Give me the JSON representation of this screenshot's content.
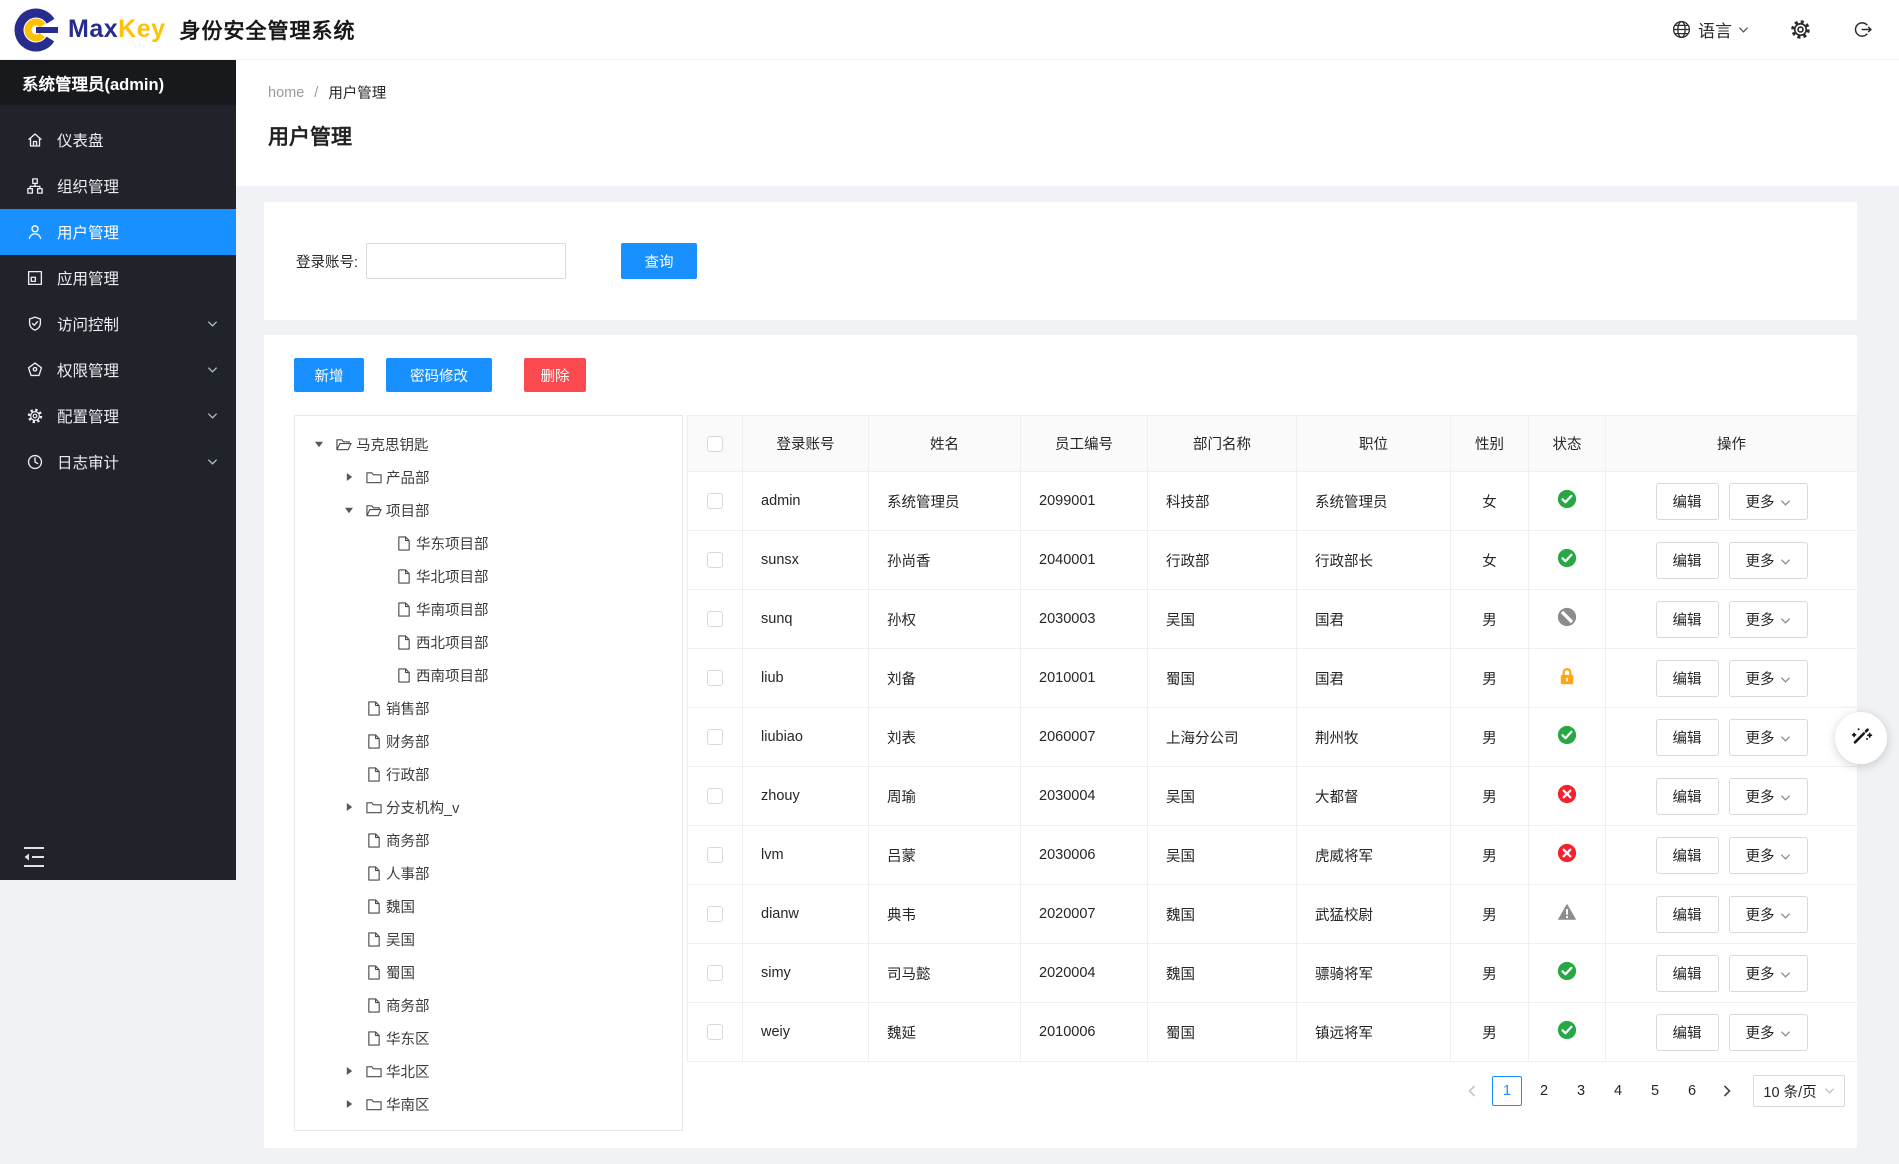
{
  "colors": {
    "primary": "#1890ff",
    "danger": "#fb4b50",
    "page-bg": "#f0f2f5",
    "sidebar-bg": "#20232a",
    "sidebar-active": "#1890ff",
    "brand-navy": "#272c8e",
    "brand-gold": "#fdc106",
    "status-active": "#28a745",
    "status-error": "#f5222d",
    "status-locked": "#ffa514",
    "status-disabled": "#8c8c8c"
  },
  "topbar": {
    "brand_max": "Max",
    "brand_key": "Key",
    "brand_product": "身份安全管理系统",
    "language_label": "语言"
  },
  "sidebar": {
    "user_label": "系统管理员(admin)",
    "items": [
      {
        "id": "dashboard",
        "label": "仪表盘",
        "icon": "home",
        "active": false,
        "expandable": false
      },
      {
        "id": "org",
        "label": "组织管理",
        "icon": "cluster",
        "active": false,
        "expandable": false
      },
      {
        "id": "user",
        "label": "用户管理",
        "icon": "user",
        "active": true,
        "expandable": false
      },
      {
        "id": "app",
        "label": "应用管理",
        "icon": "appstore",
        "active": false,
        "expandable": false
      },
      {
        "id": "access",
        "label": "访问控制",
        "icon": "shield",
        "active": false,
        "expandable": true
      },
      {
        "id": "permission",
        "label": "权限管理",
        "icon": "pentagon",
        "active": false,
        "expandable": true
      },
      {
        "id": "config",
        "label": "配置管理",
        "icon": "gear",
        "active": false,
        "expandable": true
      },
      {
        "id": "audit",
        "label": "日志审计",
        "icon": "clock",
        "active": false,
        "expandable": true
      }
    ]
  },
  "breadcrumb": {
    "home": "home",
    "separator": "/",
    "current": "用户管理"
  },
  "page": {
    "title": "用户管理"
  },
  "search": {
    "label": "登录账号:",
    "value": "",
    "button": "查询"
  },
  "toolbar": {
    "add": "新增",
    "change_password": "密码修改",
    "delete": "删除"
  },
  "tree": {
    "items": [
      {
        "label": "马克思钥匙",
        "level": 0,
        "node": "folder-open",
        "caret": "down"
      },
      {
        "label": "产品部",
        "level": 1,
        "node": "folder",
        "caret": "right"
      },
      {
        "label": "项目部",
        "level": 1,
        "node": "folder-open",
        "caret": "down"
      },
      {
        "label": "华东项目部",
        "level": 2,
        "node": "file",
        "caret": "none"
      },
      {
        "label": "华北项目部",
        "level": 2,
        "node": "file",
        "caret": "none"
      },
      {
        "label": "华南项目部",
        "level": 2,
        "node": "file",
        "caret": "none"
      },
      {
        "label": "西北项目部",
        "level": 2,
        "node": "file",
        "caret": "none"
      },
      {
        "label": "西南项目部",
        "level": 2,
        "node": "file",
        "caret": "none"
      },
      {
        "label": "销售部",
        "level": 1,
        "node": "file",
        "caret": "none"
      },
      {
        "label": "财务部",
        "level": 1,
        "node": "file",
        "caret": "none"
      },
      {
        "label": "行政部",
        "level": 1,
        "node": "file",
        "caret": "none"
      },
      {
        "label": "分支机构_v",
        "level": 1,
        "node": "folder",
        "caret": "right"
      },
      {
        "label": "商务部",
        "level": 1,
        "node": "file",
        "caret": "none"
      },
      {
        "label": "人事部",
        "level": 1,
        "node": "file",
        "caret": "none"
      },
      {
        "label": "魏国",
        "level": 1,
        "node": "file",
        "caret": "none"
      },
      {
        "label": "吴国",
        "level": 1,
        "node": "file",
        "caret": "none"
      },
      {
        "label": "蜀国",
        "level": 1,
        "node": "file",
        "caret": "none"
      },
      {
        "label": "商务部",
        "level": 1,
        "node": "file",
        "caret": "none"
      },
      {
        "label": "华东区",
        "level": 1,
        "node": "file",
        "caret": "none"
      },
      {
        "label": "华北区",
        "level": 1,
        "node": "folder",
        "caret": "right"
      },
      {
        "label": "华南区",
        "level": 1,
        "node": "folder",
        "caret": "right"
      }
    ]
  },
  "table": {
    "columns": [
      "登录账号",
      "姓名",
      "员工编号",
      "部门名称",
      "职位",
      "性别",
      "状态",
      "操作"
    ],
    "actions": {
      "edit": "编辑",
      "more": "更多"
    },
    "rows": [
      {
        "login": "admin",
        "name": "系统管理员",
        "empno": "2099001",
        "dept": "科技部",
        "position": "系统管理员",
        "gender": "女",
        "status": "active"
      },
      {
        "login": "sunsx",
        "name": "孙尚香",
        "empno": "2040001",
        "dept": "行政部",
        "position": "行政部长",
        "gender": "女",
        "status": "active"
      },
      {
        "login": "sunq",
        "name": "孙权",
        "empno": "2030003",
        "dept": "吴国",
        "position": "国君",
        "gender": "男",
        "status": "disabled"
      },
      {
        "login": "liub",
        "name": "刘备",
        "empno": "2010001",
        "dept": "蜀国",
        "position": "国君",
        "gender": "男",
        "status": "locked"
      },
      {
        "login": "liubiao",
        "name": "刘表",
        "empno": "2060007",
        "dept": "上海分公司",
        "position": "荆州牧",
        "gender": "男",
        "status": "active"
      },
      {
        "login": "zhouy",
        "name": "周瑜",
        "empno": "2030004",
        "dept": "吴国",
        "position": "大都督",
        "gender": "男",
        "status": "error"
      },
      {
        "login": "lvm",
        "name": "吕蒙",
        "empno": "2030006",
        "dept": "吴国",
        "position": "虎威将军",
        "gender": "男",
        "status": "error"
      },
      {
        "login": "dianw",
        "name": "典韦",
        "empno": "2020007",
        "dept": "魏国",
        "position": "武猛校尉",
        "gender": "男",
        "status": "warning"
      },
      {
        "login": "simy",
        "name": "司马懿",
        "empno": "2020004",
        "dept": "魏国",
        "position": "骠骑将军",
        "gender": "男",
        "status": "active"
      },
      {
        "login": "weiy",
        "name": "魏延",
        "empno": "2010006",
        "dept": "蜀国",
        "position": "镇远将军",
        "gender": "男",
        "status": "active"
      }
    ]
  },
  "pagination": {
    "prev_enabled": false,
    "next_enabled": true,
    "pages": [
      "1",
      "2",
      "3",
      "4",
      "5",
      "6"
    ],
    "current": "1",
    "page_size": "10 条/页"
  }
}
